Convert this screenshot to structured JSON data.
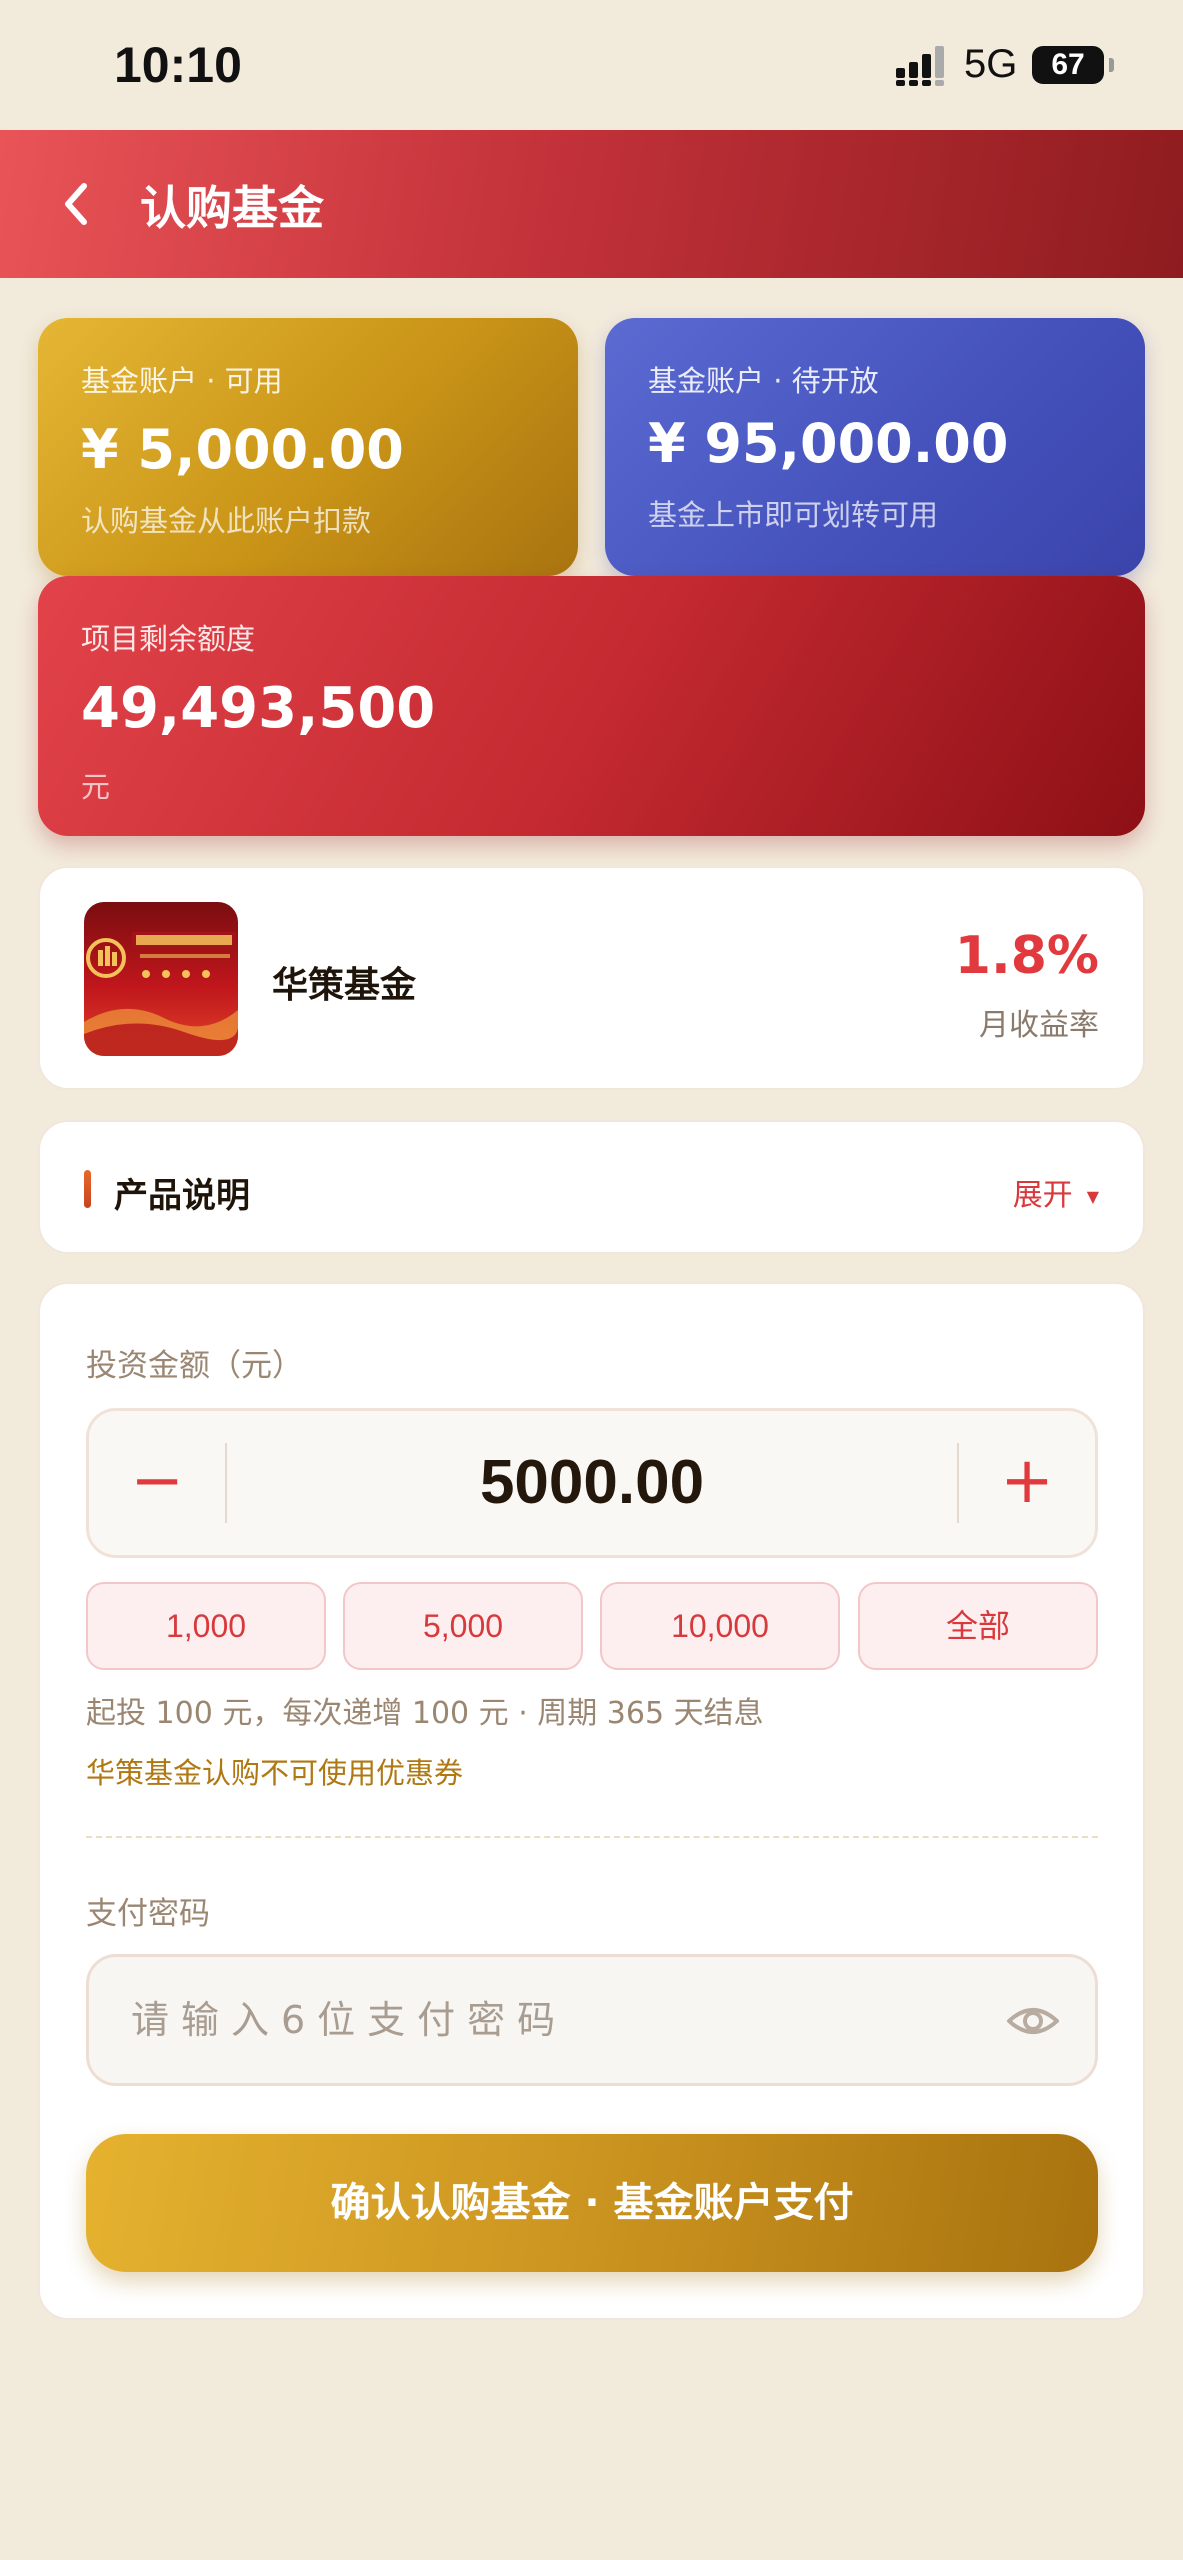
{
  "status_bar": {
    "time": "10:10",
    "network": "5G",
    "battery": "67"
  },
  "header": {
    "title": "认购基金"
  },
  "accounts": {
    "available": {
      "label": "基金账户 · 可用",
      "amount": "¥ 5,000.00",
      "note": "认购基金从此账户扣款"
    },
    "pending": {
      "label": "基金账户 · 待开放",
      "amount": "¥ 95,000.00",
      "note": "基金上市即可划转可用"
    },
    "quota": {
      "label": "项目剩余额度",
      "amount": "49,493,500",
      "unit": "元"
    }
  },
  "fund": {
    "name": "华策基金",
    "rate": "1.8%",
    "rate_label": "月收益率"
  },
  "description": {
    "title": "产品说明",
    "toggle": "展开"
  },
  "form": {
    "amount_label": "投资金额（元）",
    "amount_value": "5000.00",
    "minus": "−",
    "plus": "+",
    "quick_amounts": [
      "1,000",
      "5,000",
      "10,000",
      "全部"
    ],
    "rule": "起投 100 元，每次递增 100 元 · 周期 365 天结息",
    "coupon_note": "华策基金认购不可使用优惠券",
    "password_label": "支付密码",
    "password_placeholder": "请输入6位支付密码",
    "confirm": "确认认购基金 · 基金账户支付"
  },
  "colors": {
    "accent_red": "#e03a3e",
    "gold": "#c99417",
    "blue": "#4653bd",
    "background": "#f2eadb"
  }
}
